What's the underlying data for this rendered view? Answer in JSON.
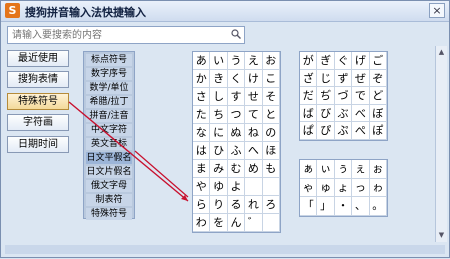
{
  "window": {
    "title": "搜狗拼音输入法快捷输入",
    "app_icon": "S",
    "close_label": "×"
  },
  "search": {
    "placeholder": "请输入要搜索的内容"
  },
  "left_buttons": [
    {
      "label": "最近使用"
    },
    {
      "label": "搜狗表情"
    },
    {
      "label": "特殊符号"
    },
    {
      "label": "字符画"
    },
    {
      "label": "日期时间"
    }
  ],
  "categories": [
    {
      "label": "标点符号"
    },
    {
      "label": "数字序号"
    },
    {
      "label": "数学/单位"
    },
    {
      "label": "希腊/拉丁"
    },
    {
      "label": "拼音/注音"
    },
    {
      "label": "中文字符"
    },
    {
      "label": "英文音标"
    },
    {
      "label": "日文平假名"
    },
    {
      "label": "日文片假名"
    },
    {
      "label": "俄文字母"
    },
    {
      "label": "制表符"
    },
    {
      "label": "特殊符号"
    }
  ],
  "grid1": [
    [
      "あ",
      "い",
      "う",
      "え",
      "お"
    ],
    [
      "か",
      "き",
      "く",
      "け",
      "こ"
    ],
    [
      "さ",
      "し",
      "す",
      "せ",
      "そ"
    ],
    [
      "た",
      "ち",
      "つ",
      "て",
      "と"
    ],
    [
      "な",
      "に",
      "ぬ",
      "ね",
      "の"
    ],
    [
      "は",
      "ひ",
      "ふ",
      "へ",
      "ほ"
    ],
    [
      "ま",
      "み",
      "む",
      "め",
      "も"
    ],
    [
      "や",
      "ゆ",
      "よ",
      "",
      ""
    ],
    [
      "ら",
      "り",
      "る",
      "れ",
      "ろ"
    ],
    [
      "わ",
      "を",
      "ん",
      "゛",
      ""
    ]
  ],
  "grid2": [
    [
      "が",
      "ぎ",
      "ぐ",
      "げ",
      "ご"
    ],
    [
      "ざ",
      "じ",
      "ず",
      "ぜ",
      "ぞ"
    ],
    [
      "だ",
      "ぢ",
      "づ",
      "で",
      "ど"
    ],
    [
      "ば",
      "び",
      "ぶ",
      "べ",
      "ぼ"
    ],
    [
      "ぱ",
      "ぴ",
      "ぷ",
      "ぺ",
      "ぽ"
    ]
  ],
  "grid3": [
    [
      "ぁ",
      "ぃ",
      "ぅ",
      "ぇ",
      "ぉ"
    ],
    [
      "ゃ",
      "ゅ",
      "ょ",
      "っ",
      "ゎ"
    ],
    [
      "「",
      "」",
      "・",
      "、",
      "。"
    ]
  ],
  "colors": {
    "accent": "#c8102e",
    "frame": "#dbe6f2"
  }
}
